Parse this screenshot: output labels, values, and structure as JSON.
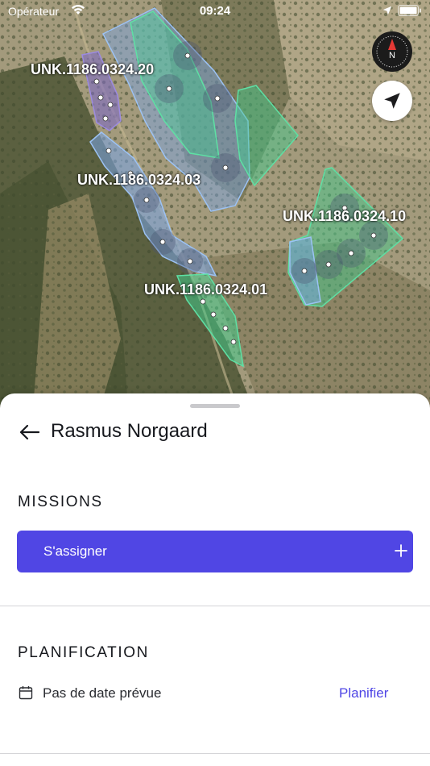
{
  "status_bar": {
    "carrier": "Opérateur",
    "time": "09:24"
  },
  "map": {
    "compass_letter": "N",
    "plots": [
      {
        "label": "UNK.1186.0324.20",
        "color": "#7b68c8"
      },
      {
        "label": "UNK.1186.0324.03",
        "color": "#7aa6e8"
      },
      {
        "label": "UNK.1186.0324.10",
        "color": "#3ecf8e"
      },
      {
        "label": "UNK.1186.0324.01",
        "color": "#3ecf8e"
      }
    ]
  },
  "sheet": {
    "title": "Rasmus Norgaard",
    "missions": {
      "heading": "MISSIONS",
      "assign_label": "S'assigner",
      "assign_icon": "plus-icon"
    },
    "planning": {
      "heading": "PLANIFICATION",
      "no_date_text": "Pas de date prévue",
      "plan_link": "Planifier"
    }
  },
  "colors": {
    "accent": "#5046e4",
    "link": "#4f46e5"
  }
}
